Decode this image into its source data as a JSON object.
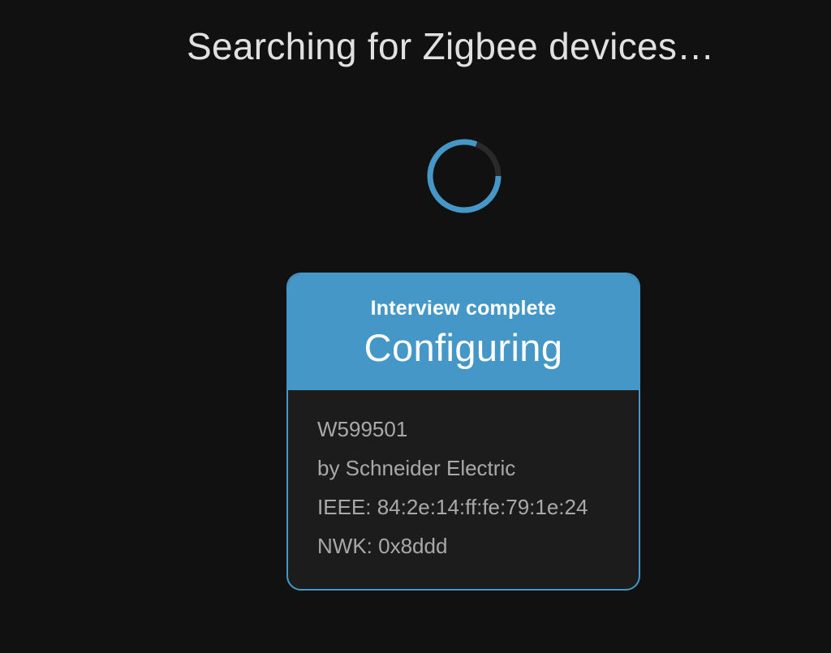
{
  "header": {
    "title": "Searching for Zigbee devices…"
  },
  "spinner": {
    "icon": "progress-spinner-icon",
    "color": "#4597c7",
    "track_color": "#2a2a2a"
  },
  "device_card": {
    "status_label": "Interview complete",
    "state_label": "Configuring",
    "model": "W599501",
    "manufacturer": "by Schneider Electric",
    "ieee": "IEEE: 84:2e:14:ff:fe:79:1e:24",
    "nwk": "NWK: 0x8ddd",
    "accent_color": "#4597c7"
  }
}
